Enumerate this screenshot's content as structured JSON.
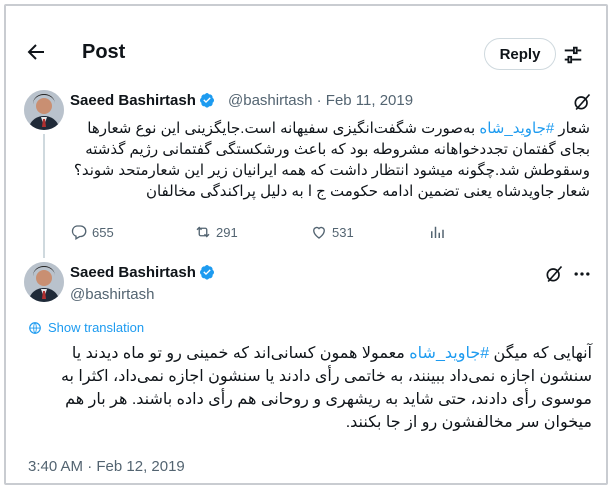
{
  "header": {
    "title": "Post",
    "reply_label": "Reply"
  },
  "post1": {
    "author_name": "Saeed Bashirtash",
    "handle": "@bashirtash",
    "date_sep": "·",
    "date": "Feb 11, 2019",
    "text_before_tag": "شعار ",
    "hashtag": "#جاوید_شاه",
    "text_after_tag": " به‌صورت شگفت‌انگیزی سفیهانه است.جایگزینی این نوع شعارها بجای گفتمان تجددخواهانه مشروطه بود که باعث ورشکستگی گفتمانی رژیم گذشته وسقوطش شد.چگونه میشود انتظار داشت که همه ایرانیان زیر این شعارمتحد شوند؟شعار جاویدشاه یعنی تضمین ادامه حکومت ج ا به دلیل پراکندگی مخالفان",
    "stats": {
      "replies": "655",
      "reposts": "291",
      "likes": "531"
    }
  },
  "post2": {
    "author_name": "Saeed Bashirtash",
    "handle": "@bashirtash",
    "show_translation": "Show translation",
    "text_before_tag": "آنهایی که میگن ",
    "hashtag": "#جاوید_شاه",
    "text_after_tag": " معمولا همون کسانی‌اند که خمینی رو تو ماه دیدند یا سنشون اجازه نمی‌داد ببینند، به خاتمی رأی دادند یا سنشون اجازه نمی‌داد، اکثرا به موسوی رأی دادند، حتی شاید به ریشهری و روحانی هم رأی داده باشند. هر بار هم میخوان سر مخالفشون رو از جا بکنند.",
    "timestamp": "3:40 AM · Feb 12, 2019"
  },
  "colors": {
    "accent": "#1d9bf0",
    "muted": "#536471",
    "border": "#cfd9de",
    "text": "#0f1419"
  }
}
